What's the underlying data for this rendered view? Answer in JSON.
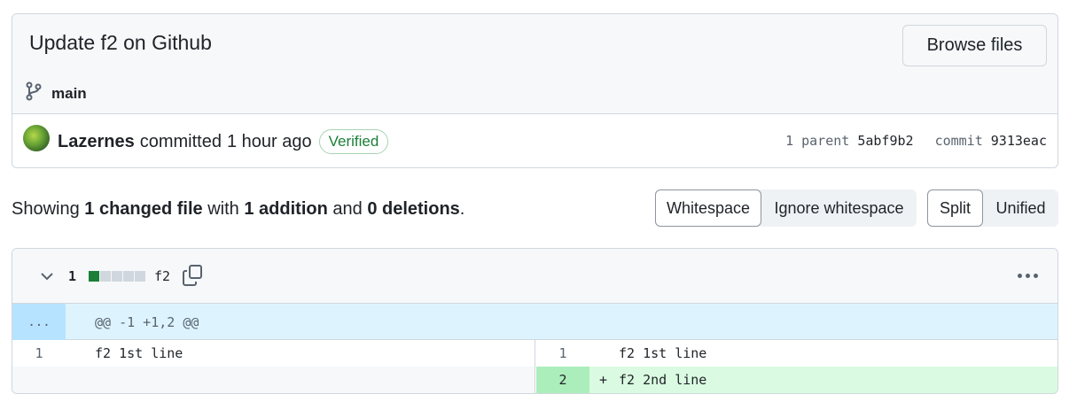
{
  "commit": {
    "title": "Update f2 on Github",
    "browse_label": "Browse files",
    "branch": "main",
    "author": "Lazernes",
    "action": "committed",
    "time": "1 hour ago",
    "verified": "Verified",
    "parent_label": "1 parent",
    "parent_sha": "5abf9b2",
    "commit_label": "commit",
    "commit_sha": "9313eac"
  },
  "summary": {
    "showing": "Showing",
    "changed_files": "1 changed file",
    "with": "with",
    "additions": "1 addition",
    "and": "and",
    "deletions": "0 deletions",
    "period": "."
  },
  "toggles": {
    "whitespace": "Whitespace",
    "ignore_whitespace": "Ignore whitespace",
    "split": "Split",
    "unified": "Unified"
  },
  "file": {
    "change_count": "1",
    "name": "f2",
    "diffstat": [
      "add",
      "neutral",
      "neutral",
      "neutral",
      "neutral"
    ],
    "hunk_expand": "...",
    "hunk_header": "@@ -1 +1,2 @@",
    "rows": [
      {
        "left_num": "1",
        "left_code": "f2 1st line",
        "right_num": "1",
        "right_code": "f2 1st line"
      },
      {
        "left_num": "",
        "left_code": "",
        "right_num": "2",
        "right_sign": "+",
        "right_code": "f2 2nd line"
      }
    ]
  },
  "colors": {
    "addition_bg": "#dafbe1",
    "addition_num_bg": "#aceebb",
    "hunk_bg": "#ddf4ff",
    "verified": "#1a7f37"
  },
  "icons": [
    "git-branch-icon",
    "chevron-down-icon",
    "copy-icon",
    "kebab-horizontal-icon"
  ]
}
